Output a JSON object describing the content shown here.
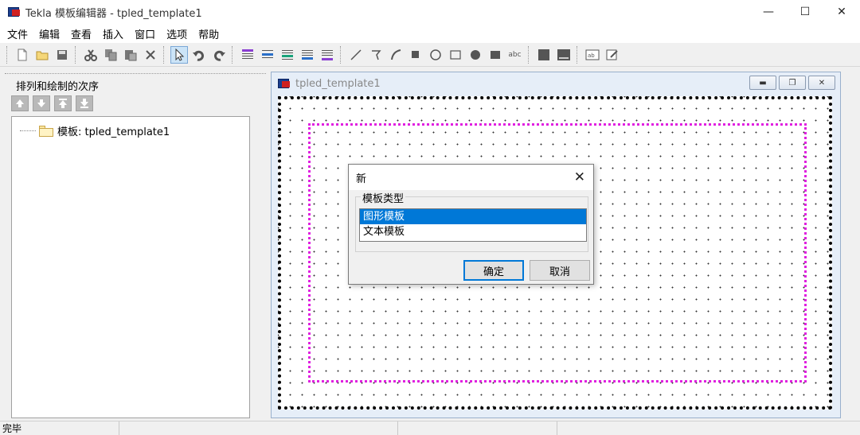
{
  "app": {
    "title": "Tekla 模板编辑器 - tpled_template1",
    "window_controls": {
      "minimize": "—",
      "maximize": "☐",
      "close": "✕"
    }
  },
  "menu": {
    "items": [
      "文件",
      "编辑",
      "查看",
      "插入",
      "窗口",
      "选项",
      "帮助"
    ]
  },
  "toolbar": {
    "buttons": [
      "new",
      "open",
      "save",
      "cut",
      "copy",
      "paste",
      "delete",
      "select-pointer",
      "undo",
      "redo",
      "row-header",
      "row-page",
      "row-data",
      "row-footer",
      "row-end",
      "line",
      "polygon",
      "arc",
      "fill",
      "circle",
      "rectangle",
      "filled-circle",
      "filled-rectangle",
      "text-abc",
      "block",
      "block-2",
      "value-field",
      "edit-field"
    ],
    "text_icon_label": "abc"
  },
  "left_panel": {
    "title": "排列和绘制的次序",
    "tree_item": "模板: tpled_template1"
  },
  "inner_window": {
    "title": "tpled_template1",
    "controls": {
      "minimize": "▬",
      "restore": "❐",
      "close": "✕"
    }
  },
  "dialog": {
    "title": "新",
    "close": "✕",
    "group_label": "模板类型",
    "options": [
      "图形模板",
      "文本模板"
    ],
    "selected_index": 0,
    "ok_label": "确定",
    "cancel_label": "取消"
  },
  "status": {
    "text": "完毕"
  },
  "colors": {
    "selection": "#0078d7",
    "frame_magenta": "#e020e0",
    "canvas_bg": "#ffffff",
    "window_chrome": "#e6eef8"
  }
}
